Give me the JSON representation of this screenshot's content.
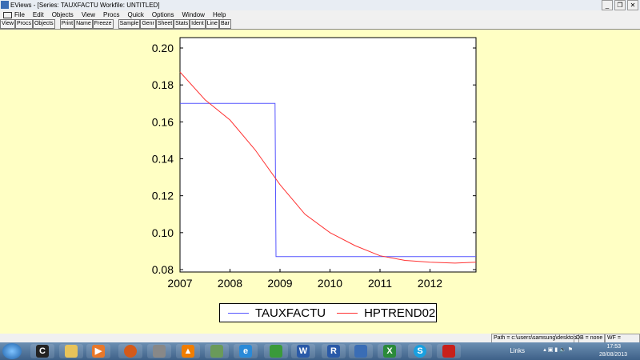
{
  "window": {
    "title": "EViews - [Series: TAUXFACTU   Workfile: UNTITLED]"
  },
  "menu": [
    "File",
    "Edit",
    "Objects",
    "View",
    "Procs",
    "Quick",
    "Options",
    "Window",
    "Help"
  ],
  "toolbar": [
    [
      "View",
      "Procs",
      "Objects"
    ],
    [
      "Print",
      "Name",
      "Freeze"
    ],
    [
      "Sample",
      "Genr",
      "Sheet",
      "Stats",
      "Ident",
      "Line",
      "Bar"
    ]
  ],
  "chart_data": {
    "type": "line",
    "xlim": [
      2007,
      2012.92
    ],
    "ylim": [
      0.08,
      0.2
    ],
    "yticks": [
      "0.08",
      "0.10",
      "0.12",
      "0.14",
      "0.16",
      "0.18",
      "0.20"
    ],
    "xticks": [
      "2007",
      "2008",
      "2009",
      "2010",
      "2011",
      "2012"
    ],
    "series": [
      {
        "name": "TAUXFACTU",
        "color": "#5555ff",
        "x": [
          2007,
          2008.9,
          2008.92,
          2012.92
        ],
        "y": [
          0.17,
          0.17,
          0.087,
          0.087
        ]
      },
      {
        "name": "HPTREND02",
        "color": "#ff3333",
        "x": [
          2007,
          2007.5,
          2008,
          2008.5,
          2009,
          2009.5,
          2010,
          2010.5,
          2011,
          2011.5,
          2012,
          2012.5,
          2012.92
        ],
        "y": [
          0.187,
          0.172,
          0.161,
          0.145,
          0.126,
          0.11,
          0.1,
          0.093,
          0.0875,
          0.085,
          0.084,
          0.0835,
          0.084
        ]
      }
    ],
    "legend_position": "bottom-center"
  },
  "status": {
    "path": "Path = c:\\users\\samsung\\desktop",
    "db": "DB = none",
    "wf": "WF = untitled"
  },
  "tray": {
    "links": "Links",
    "time": "17:53",
    "date": "28/08/2013"
  }
}
